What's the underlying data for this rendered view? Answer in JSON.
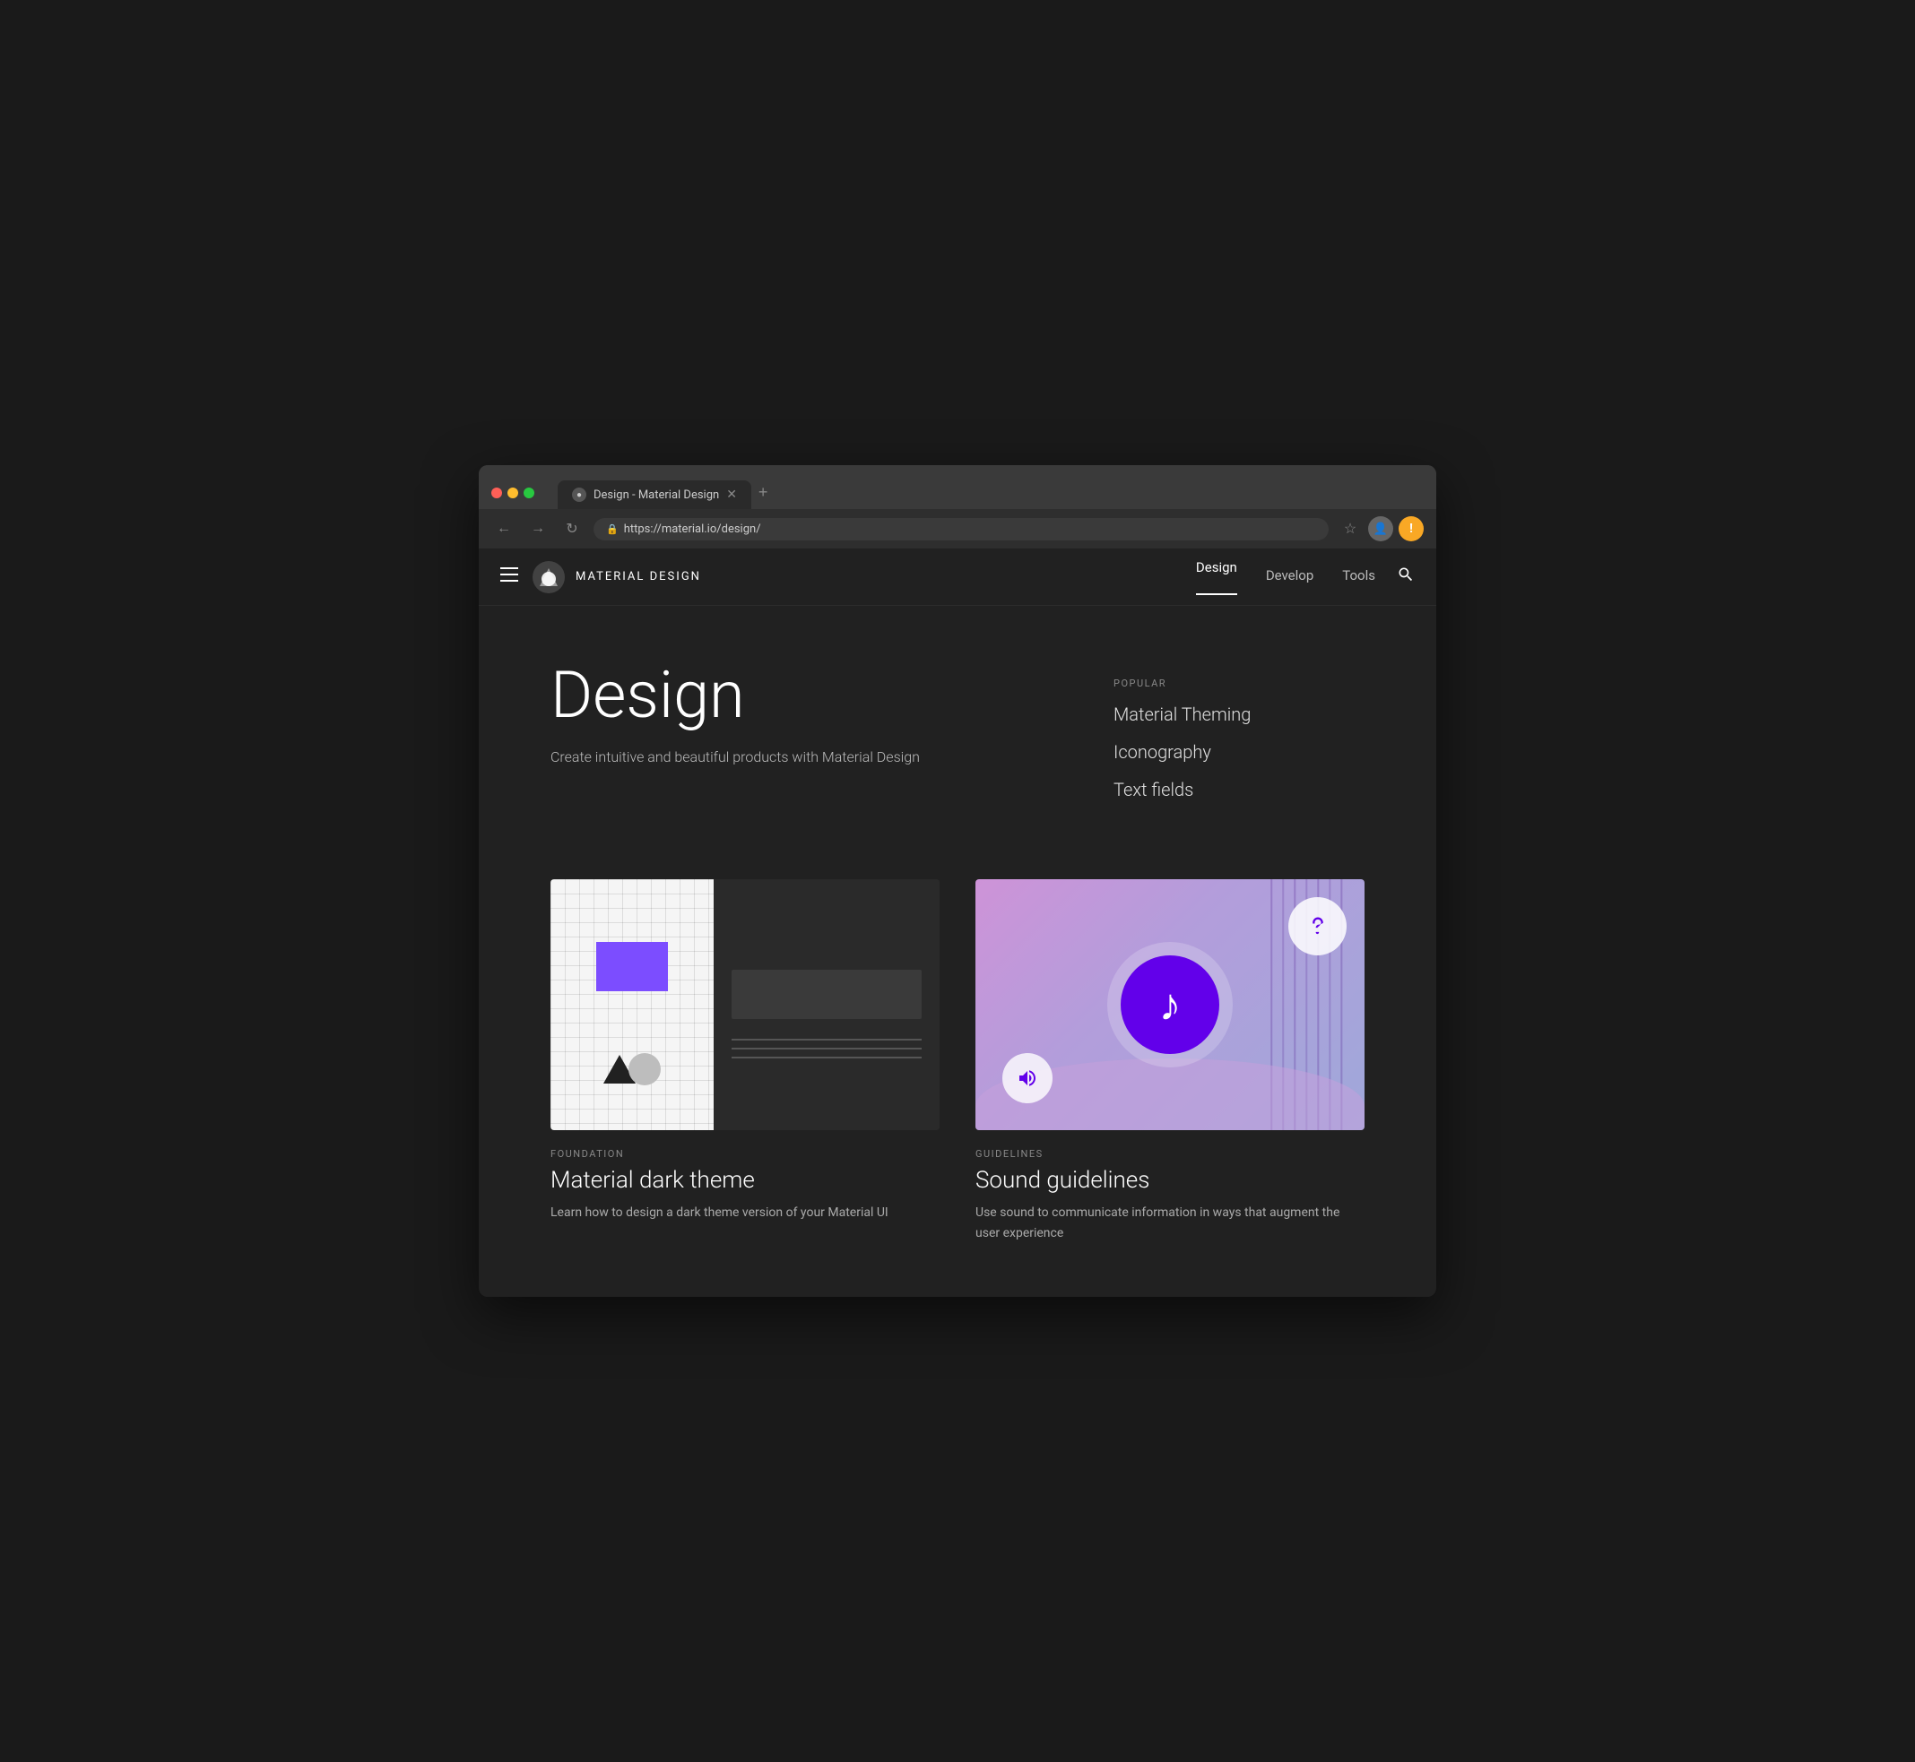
{
  "browser": {
    "tab_title": "Design - Material Design",
    "url": "https://material.io/design/",
    "new_tab_label": "+",
    "back_btn": "←",
    "forward_btn": "→",
    "refresh_btn": "↻"
  },
  "nav": {
    "menu_label": "☰",
    "logo_text": "MATERIAL DESIGN",
    "links": [
      {
        "label": "Design",
        "active": true
      },
      {
        "label": "Develop",
        "active": false
      },
      {
        "label": "Tools",
        "active": false
      }
    ],
    "search_label": "🔍"
  },
  "hero": {
    "title": "Design",
    "subtitle": "Create intuitive and beautiful products with Material Design",
    "popular_section_label": "POPULAR",
    "popular_links": [
      {
        "label": "Material Theming"
      },
      {
        "label": "Iconography"
      },
      {
        "label": "Text fields"
      }
    ]
  },
  "cards": [
    {
      "category": "FOUNDATION",
      "title": "Material dark theme",
      "desc": "Learn how to design a dark theme version of your Material UI"
    },
    {
      "category": "GUIDELINES",
      "title": "Sound guidelines",
      "desc": "Use sound to communicate information in ways that augment the user experience"
    }
  ]
}
